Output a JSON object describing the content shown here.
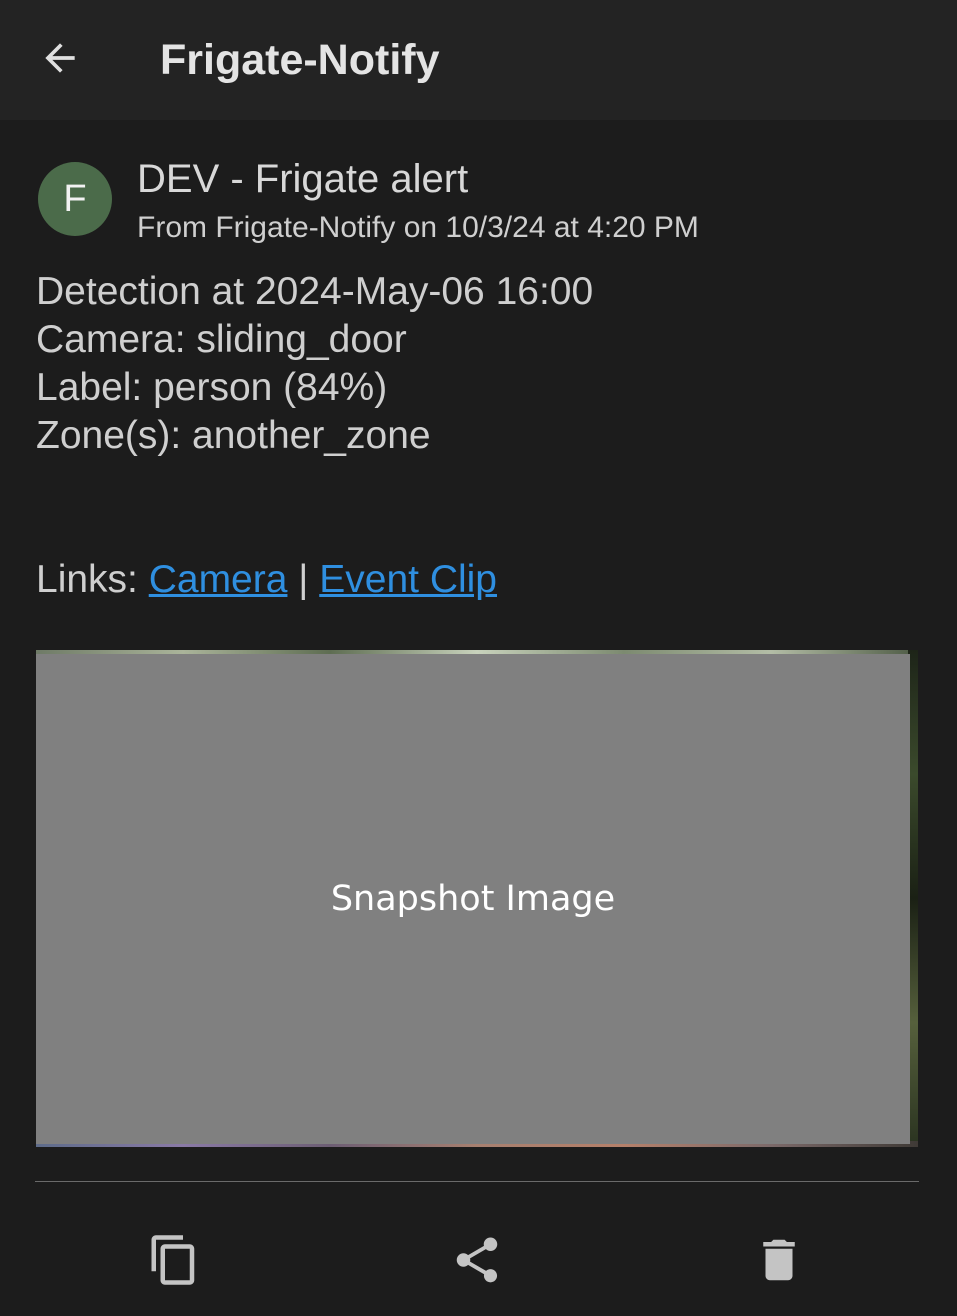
{
  "appbar": {
    "title": "Frigate-Notify",
    "back_icon": "arrow-left-icon"
  },
  "notification": {
    "avatar_letter": "F",
    "avatar_color": "#4b6b4a",
    "title": "DEV - Frigate alert",
    "meta": "From Frigate-Notify on 10/3/24 at 4:20 PM",
    "body_lines": [
      "Detection at 2024-May-06 16:00",
      "Camera: sliding_door",
      "Label: person (84%)",
      "Zone(s): another_zone"
    ],
    "links": {
      "prefix": "Links: ",
      "camera_label": "Camera",
      "separator": " | ",
      "event_clip_label": "Event Clip",
      "link_color": "#2f8fe0"
    },
    "snapshot": {
      "label": "Snapshot Image"
    }
  },
  "actions": {
    "copy_icon": "copy-icon",
    "share_icon": "share-icon",
    "delete_icon": "trash-icon"
  }
}
